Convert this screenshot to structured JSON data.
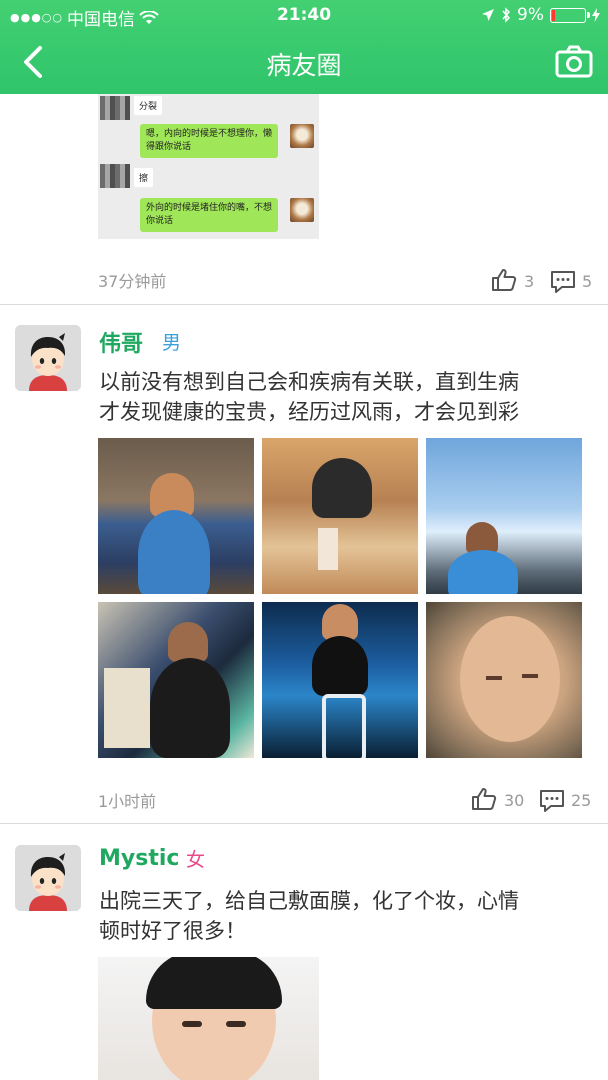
{
  "status_bar": {
    "carrier": "中国电信",
    "time": "21:40",
    "battery": "9%"
  },
  "nav": {
    "title": "病友圈"
  },
  "chat_screenshot": {
    "messages": [
      {
        "side": "left",
        "text": "分裂"
      },
      {
        "side": "right",
        "text": "嗯，内向的时候是不想理你，懒得跟你说话"
      },
      {
        "side": "left",
        "text": "擦"
      },
      {
        "side": "right",
        "text": "外向的时候是堵住你的嘴，不想你说话"
      }
    ]
  },
  "posts": [
    {
      "time": "37分钟前",
      "likes": "3",
      "comments": "5"
    },
    {
      "author": "伟哥",
      "gender": "男",
      "text_line1": "以前没有想到自己会和疾病有关联，直到生病",
      "text_line2": "才发现健康的宝贵，经历过风雨，才会见到彩",
      "photo_count": 6,
      "time": "1小时前",
      "likes": "30",
      "comments": "25"
    },
    {
      "author": "Mystic",
      "gender": "女",
      "text_line1": "出院三天了，给自己敷面膜，化了个妆，心情",
      "text_line2": "顿时好了很多！"
    }
  ],
  "colors": {
    "header_green": "#3fce70",
    "name_green": "#20a860",
    "male_blue": "#3aa0dc",
    "female_pink": "#e8478a",
    "meta_gray": "#9a9a9a"
  },
  "icons": {
    "back": "chevron-left-icon",
    "camera": "camera-icon",
    "like": "thumbs-up-icon",
    "comment": "comment-icon"
  }
}
